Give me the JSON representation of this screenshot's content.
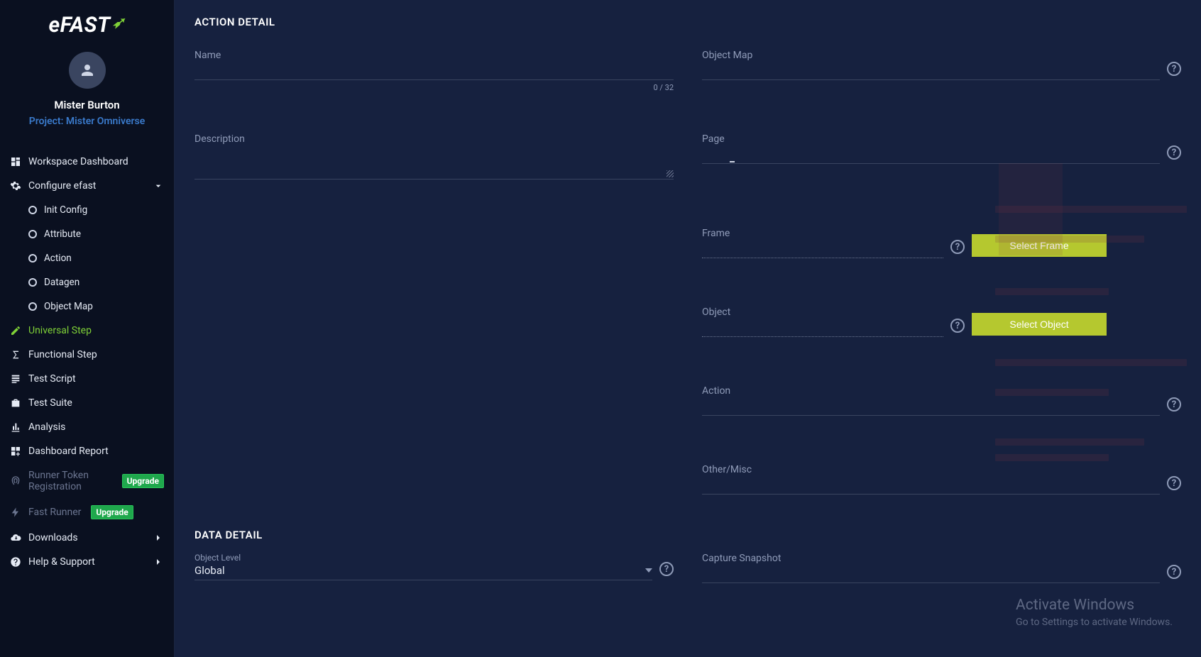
{
  "brand": {
    "part1": "e",
    "part2": "FAST"
  },
  "user": {
    "name": "Mister Burton",
    "project": "Project: Mister Omniverse"
  },
  "nav": {
    "workspace": "Workspace Dashboard",
    "configure": "Configure efast",
    "init_config": "Init Config",
    "attribute": "Attribute",
    "action": "Action",
    "datagen": "Datagen",
    "object_map": "Object Map",
    "universal_step": "Universal Step",
    "functional_step": "Functional Step",
    "test_script": "Test Script",
    "test_suite": "Test Suite",
    "analysis": "Analysis",
    "dashboard_report": "Dashboard Report",
    "runner_token": "Runner Token Registration",
    "fast_runner": "Fast Runner",
    "downloads": "Downloads",
    "help": "Help & Support",
    "upgrade": "Upgrade"
  },
  "section": {
    "action_detail": "ACTION DETAIL",
    "data_detail": "DATA DETAIL"
  },
  "fields": {
    "name": "Name",
    "name_counter": "0 / 32",
    "description": "Description",
    "object_map": "Object Map",
    "page": "Page",
    "frame": "Frame",
    "object": "Object",
    "action": "Action",
    "other": "Other/Misc",
    "object_level": "Object Level",
    "object_level_value": "Global",
    "capture_snapshot": "Capture Snapshot"
  },
  "buttons": {
    "select_frame": "Select Frame",
    "select_object": "Select Object"
  },
  "watermark": {
    "line1": "Activate Windows",
    "line2": "Go to Settings to activate Windows."
  }
}
